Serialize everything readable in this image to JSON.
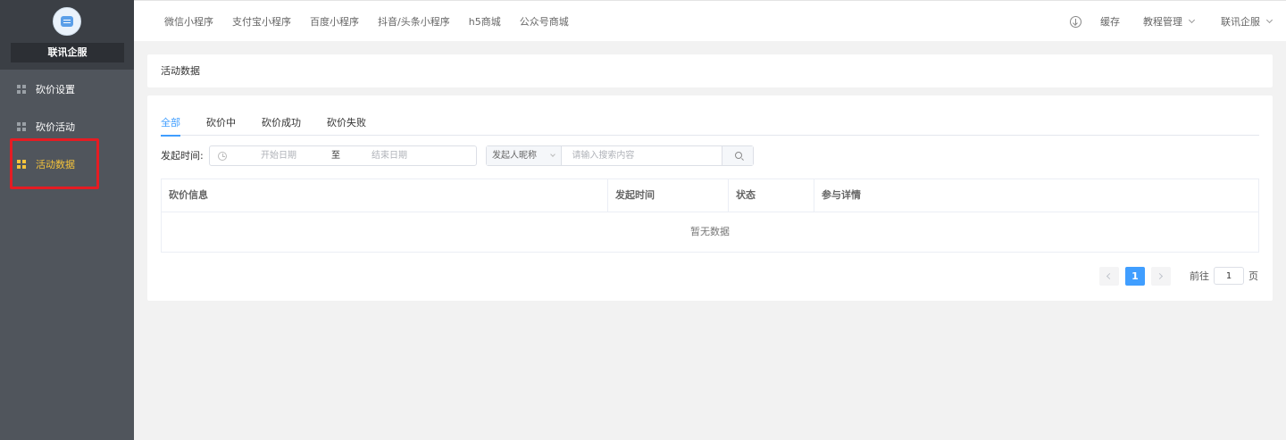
{
  "sidebar": {
    "brand_name": "联讯企服",
    "items": [
      {
        "label": "砍价设置"
      },
      {
        "label": "砍价活动"
      },
      {
        "label": "活动数据"
      }
    ]
  },
  "topbar": {
    "nav": [
      "微信小程序",
      "支付宝小程序",
      "百度小程序",
      "抖音/头条小程序",
      "h5商城",
      "公众号商城"
    ],
    "cache_label": "缓存",
    "tutorial_label": "教程管理",
    "account_label": "联讯企服"
  },
  "breadcrumb": "活动数据",
  "tabs": [
    "全部",
    "砍价中",
    "砍价成功",
    "砍价失败"
  ],
  "filter": {
    "label": "发起时间:",
    "start_placeholder": "开始日期",
    "separator": "至",
    "end_placeholder": "结束日期",
    "search_field": "发起人昵称",
    "search_placeholder": "请输入搜索内容"
  },
  "table": {
    "columns": [
      "砍价信息",
      "发起时间",
      "状态",
      "参与详情"
    ],
    "empty_text": "暂无数据"
  },
  "pagination": {
    "current_page": "1",
    "goto_label": "前往",
    "goto_value": "1",
    "goto_suffix": "页"
  },
  "colors": {
    "accent": "#409eff",
    "active_menu": "#f5c33b",
    "sidebar_bg": "#50555c",
    "highlight": "#e51c23"
  }
}
